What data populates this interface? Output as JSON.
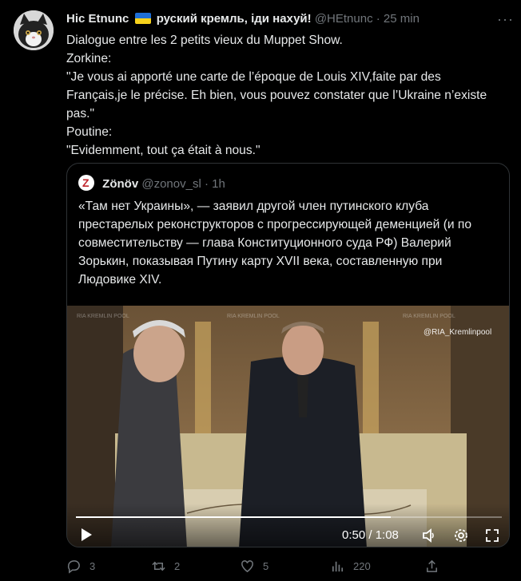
{
  "author": {
    "name": "Hic Etnunc",
    "name_suffix": "руский кремль, іди нахуй!",
    "handle": "@HEtnunc",
    "separator": "·",
    "time": "25 min",
    "more": "···"
  },
  "body_lines": [
    "Dialogue entre les 2 petits vieux du Muppet Show.",
    "Zorkine:",
    "\"Je vous ai apporté une carte de l’époque de Louis XIV,faite par des Français,je le précise. Eh bien, vous pouvez constater que l’Ukraine n’existe pas.\"",
    "Poutine:",
    "\"Evidemment, tout ça était à nous.\""
  ],
  "quote": {
    "name": "Zönöv",
    "handle": "@zonov_sl",
    "separator": "·",
    "time": "1h",
    "text": "«Там нет Украины», — заявил другой член путинского клуба престарелых реконструкторов с прогрессирующей деменцией (и по совместительству — глава Конституционного суда РФ) Валерий Зорькин, показывая Путину карту XVII века, составленную при Людовике XIV."
  },
  "video": {
    "watermark": "@RIA_Kremlinpool",
    "faint_watermark": "RIA KREMLIN POOL",
    "time_display": "0:50 / 1:08",
    "progress": 0.74
  },
  "actions": {
    "replies": "3",
    "retweets": "2",
    "likes": "5",
    "views": "220"
  },
  "colors": {
    "background": "#000000",
    "text": "#e7e9ea",
    "muted": "#71767b",
    "border": "#2f3336"
  }
}
